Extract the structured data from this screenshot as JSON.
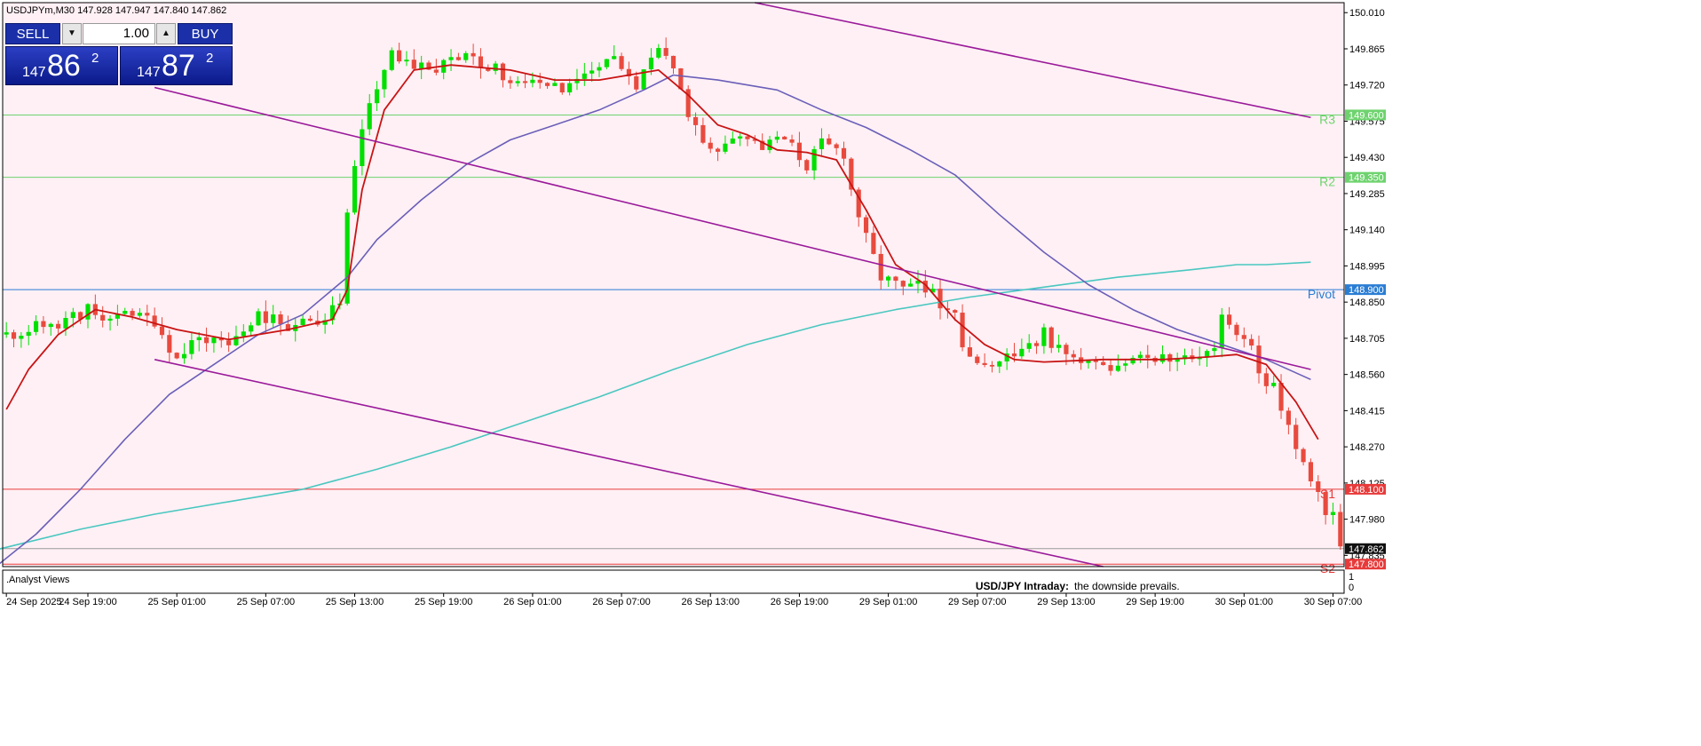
{
  "header": {
    "symbol": "USDJPYm,M30",
    "ohlc": "147.928 147.947 147.840 147.862"
  },
  "trade_panel": {
    "sell_label": "SELL",
    "buy_label": "BUY",
    "lot": "1.00",
    "sell_quote": {
      "prefix": "147",
      "big": "86",
      "sup": "2"
    },
    "buy_quote": {
      "prefix": "147",
      "big": "87",
      "sup": "2"
    }
  },
  "indicator": {
    "title": ".Analyst Views",
    "scale": [
      "1",
      "0"
    ],
    "headline": "USD/JPY Intraday:",
    "comment": "the downside prevails."
  },
  "colors": {
    "background": "#fff0f5",
    "bull": "#00e000",
    "bear": "#e84a3e",
    "ema_fast": "#c81414",
    "ma_mid": "#6a5fb8",
    "ma_slow": "#49c7c0",
    "channel": "#9a1a9a",
    "resistance": "#6ed36e",
    "pivot": "#2a7dd4",
    "support": "#e83a3a",
    "current_price": "#111111"
  },
  "chart_data": {
    "type": "candlestick",
    "timeframe": "M30",
    "ylim": [
      147.79,
      150.05
    ],
    "y_ticks": [
      "150.010",
      "149.865",
      "149.720",
      "149.575",
      "149.430",
      "149.285",
      "149.140",
      "148.995",
      "148.850",
      "148.705",
      "148.560",
      "148.415",
      "148.270",
      "148.125",
      "147.980",
      "147.835"
    ],
    "x_ticks": [
      {
        "i": 0,
        "label": "24 Sep 2025"
      },
      {
        "i": 11,
        "label": "24 Sep 19:00"
      },
      {
        "i": 23,
        "label": "25 Sep 01:00"
      },
      {
        "i": 35,
        "label": "25 Sep 07:00"
      },
      {
        "i": 47,
        "label": "25 Sep 13:00"
      },
      {
        "i": 59,
        "label": "25 Sep 19:00"
      },
      {
        "i": 71,
        "label": "26 Sep 01:00"
      },
      {
        "i": 83,
        "label": "26 Sep 07:00"
      },
      {
        "i": 95,
        "label": "26 Sep 13:00"
      },
      {
        "i": 107,
        "label": "26 Sep 19:00"
      },
      {
        "i": 119,
        "label": "29 Sep 01:00"
      },
      {
        "i": 131,
        "label": "29 Sep 07:00"
      },
      {
        "i": 143,
        "label": "29 Sep 13:00"
      },
      {
        "i": 155,
        "label": "29 Sep 19:00"
      },
      {
        "i": 167,
        "label": "30 Sep 01:00"
      },
      {
        "i": 179,
        "label": "30 Sep 07:00"
      }
    ],
    "keypoints": [
      [
        0,
        148.72
      ],
      [
        6,
        148.76
      ],
      [
        11,
        148.82
      ],
      [
        13,
        148.76
      ],
      [
        16,
        148.8
      ],
      [
        20,
        148.78
      ],
      [
        23,
        148.62
      ],
      [
        26,
        148.72
      ],
      [
        30,
        148.68
      ],
      [
        34,
        148.8
      ],
      [
        38,
        148.76
      ],
      [
        42,
        148.78
      ],
      [
        45,
        148.85
      ],
      [
        46,
        149.2
      ],
      [
        48,
        149.55
      ],
      [
        50,
        149.72
      ],
      [
        52,
        149.86
      ],
      [
        55,
        149.8
      ],
      [
        58,
        149.8
      ],
      [
        62,
        149.82
      ],
      [
        66,
        149.78
      ],
      [
        70,
        149.72
      ],
      [
        74,
        149.7
      ],
      [
        78,
        149.76
      ],
      [
        81,
        149.82
      ],
      [
        85,
        149.72
      ],
      [
        88,
        149.86
      ],
      [
        90,
        149.78
      ],
      [
        92,
        149.62
      ],
      [
        95,
        149.45
      ],
      [
        98,
        149.5
      ],
      [
        102,
        149.46
      ],
      [
        105,
        149.5
      ],
      [
        108,
        149.4
      ],
      [
        110,
        149.48
      ],
      [
        113,
        149.45
      ],
      [
        114,
        149.3
      ],
      [
        116,
        149.1
      ],
      [
        118,
        148.95
      ],
      [
        121,
        148.9
      ],
      [
        125,
        148.9
      ],
      [
        126,
        148.8
      ],
      [
        128,
        148.8
      ],
      [
        129,
        148.65
      ],
      [
        131,
        148.58
      ],
      [
        134,
        148.6
      ],
      [
        137,
        148.68
      ],
      [
        140,
        148.72
      ],
      [
        142,
        148.66
      ],
      [
        145,
        148.6
      ],
      [
        149,
        148.6
      ],
      [
        152,
        148.62
      ],
      [
        156,
        148.64
      ],
      [
        160,
        148.6
      ],
      [
        163,
        148.65
      ],
      [
        164,
        148.78
      ],
      [
        166,
        148.74
      ],
      [
        168,
        148.7
      ],
      [
        169,
        148.58
      ],
      [
        171,
        148.5
      ],
      [
        173,
        148.35
      ],
      [
        175,
        148.2
      ],
      [
        177,
        148.1
      ],
      [
        178,
        148.0
      ],
      [
        179,
        147.98
      ],
      [
        180,
        147.88
      ]
    ],
    "ema_fast": [
      [
        0,
        148.42
      ],
      [
        3,
        148.58
      ],
      [
        7,
        148.72
      ],
      [
        12,
        148.82
      ],
      [
        17,
        148.79
      ],
      [
        23,
        148.74
      ],
      [
        30,
        148.7
      ],
      [
        38,
        148.74
      ],
      [
        44,
        148.78
      ],
      [
        46,
        148.9
      ],
      [
        48,
        149.3
      ],
      [
        51,
        149.62
      ],
      [
        55,
        149.78
      ],
      [
        60,
        149.8
      ],
      [
        68,
        149.78
      ],
      [
        74,
        149.74
      ],
      [
        80,
        149.74
      ],
      [
        84,
        149.76
      ],
      [
        88,
        149.78
      ],
      [
        92,
        149.68
      ],
      [
        96,
        149.56
      ],
      [
        100,
        149.52
      ],
      [
        104,
        149.46
      ],
      [
        108,
        149.45
      ],
      [
        112,
        149.42
      ],
      [
        116,
        149.22
      ],
      [
        120,
        149.0
      ],
      [
        124,
        148.92
      ],
      [
        128,
        148.78
      ],
      [
        132,
        148.68
      ],
      [
        136,
        148.62
      ],
      [
        140,
        148.61
      ],
      [
        148,
        148.62
      ],
      [
        156,
        148.62
      ],
      [
        162,
        148.63
      ],
      [
        166,
        148.64
      ],
      [
        170,
        148.6
      ],
      [
        174,
        148.45
      ],
      [
        177,
        148.3
      ]
    ],
    "ma_mid": [
      [
        -1,
        147.8
      ],
      [
        4,
        147.92
      ],
      [
        10,
        148.1
      ],
      [
        16,
        148.3
      ],
      [
        22,
        148.48
      ],
      [
        28,
        148.6
      ],
      [
        34,
        148.72
      ],
      [
        40,
        148.8
      ],
      [
        46,
        148.95
      ],
      [
        50,
        149.1
      ],
      [
        56,
        149.26
      ],
      [
        62,
        149.4
      ],
      [
        68,
        149.5
      ],
      [
        74,
        149.56
      ],
      [
        80,
        149.62
      ],
      [
        86,
        149.7
      ],
      [
        90,
        149.76
      ],
      [
        96,
        149.74
      ],
      [
        104,
        149.7
      ],
      [
        110,
        149.62
      ],
      [
        116,
        149.55
      ],
      [
        122,
        149.46
      ],
      [
        128,
        149.36
      ],
      [
        134,
        149.2
      ],
      [
        140,
        149.05
      ],
      [
        146,
        148.92
      ],
      [
        152,
        148.82
      ],
      [
        158,
        148.74
      ],
      [
        164,
        148.68
      ],
      [
        170,
        148.62
      ],
      [
        176,
        148.54
      ]
    ],
    "ma_slow": [
      [
        -1,
        147.86
      ],
      [
        10,
        147.94
      ],
      [
        20,
        148.0
      ],
      [
        30,
        148.05
      ],
      [
        40,
        148.1
      ],
      [
        50,
        148.18
      ],
      [
        60,
        148.27
      ],
      [
        70,
        148.37
      ],
      [
        80,
        148.47
      ],
      [
        90,
        148.58
      ],
      [
        100,
        148.68
      ],
      [
        110,
        148.76
      ],
      [
        120,
        148.82
      ],
      [
        130,
        148.87
      ],
      [
        140,
        148.91
      ],
      [
        150,
        148.95
      ],
      [
        160,
        148.98
      ],
      [
        166,
        149.0
      ],
      [
        170,
        149.0
      ],
      [
        176,
        149.01
      ]
    ],
    "channel_lines": [
      {
        "from": [
          101,
          150.05
        ],
        "to": [
          176,
          149.59
        ]
      },
      {
        "from": [
          20,
          149.71
        ],
        "to": [
          176,
          148.58
        ]
      },
      {
        "from": [
          20,
          148.62
        ],
        "to": [
          148,
          147.79
        ]
      }
    ],
    "levels": [
      {
        "label": "R3",
        "value": "149.600",
        "color": "#6ed36e"
      },
      {
        "label": "R2",
        "value": "149.350",
        "color": "#6ed36e"
      },
      {
        "label": "Pivot",
        "value": "148.900",
        "color": "#2a7dd4"
      },
      {
        "label": "S1",
        "value": "148.100",
        "color": "#e83a3a"
      },
      {
        "label": "S2",
        "value": "147.800",
        "color": "#e83a3a"
      }
    ],
    "current_price": "147.862",
    "bid_line": 147.862
  }
}
